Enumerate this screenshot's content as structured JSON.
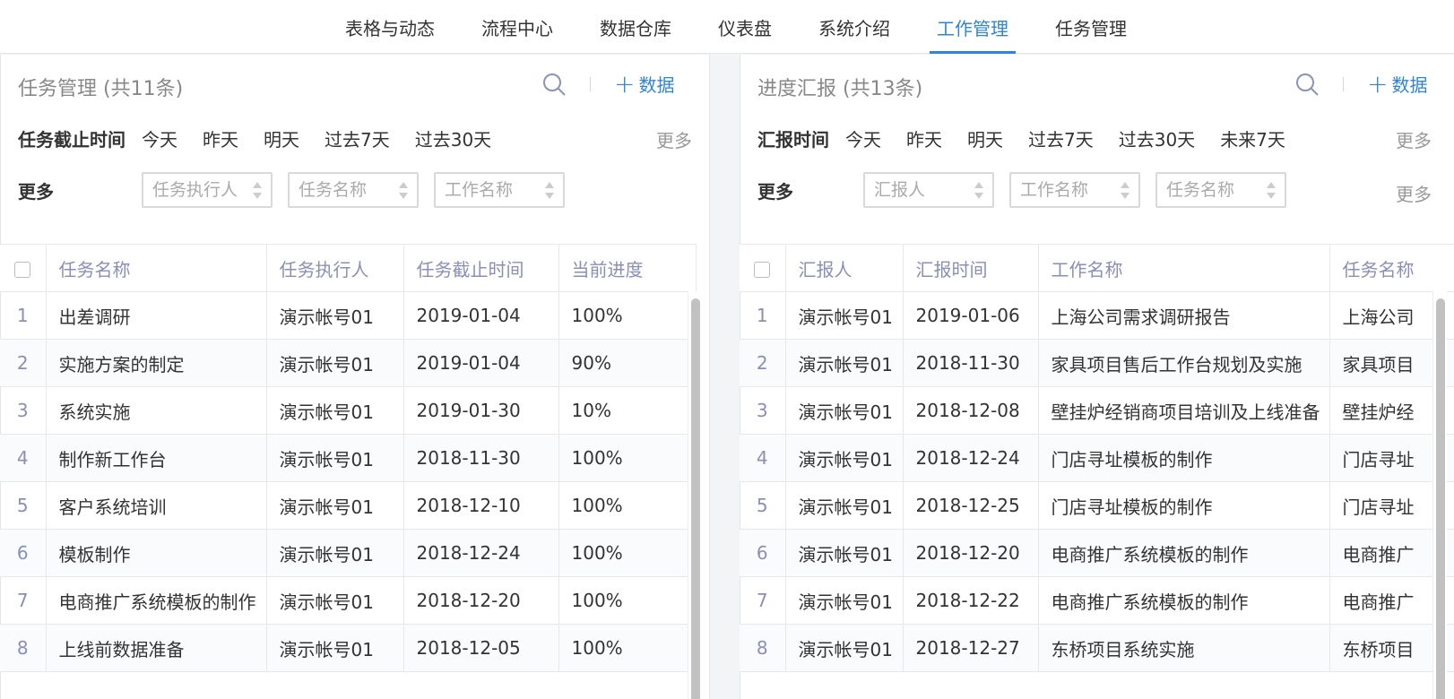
{
  "nav": {
    "tabs": [
      {
        "label": "表格与动态"
      },
      {
        "label": "流程中心"
      },
      {
        "label": "数据仓库"
      },
      {
        "label": "仪表盘"
      },
      {
        "label": "系统介绍"
      },
      {
        "label": "工作管理"
      },
      {
        "label": "任务管理"
      }
    ],
    "active_tab": "工作管理"
  },
  "left": {
    "title": "任务管理 (共11条)",
    "add_label": "数据",
    "filter_label": "任务截止时间",
    "filter_options": [
      "今天",
      "昨天",
      "明天",
      "过去7天",
      "过去30天"
    ],
    "more_label": "更多",
    "more_row_label": "更多",
    "selects": [
      {
        "placeholder": "任务执行人"
      },
      {
        "placeholder": "任务名称"
      },
      {
        "placeholder": "工作名称"
      }
    ],
    "columns": [
      "任务名称",
      "任务执行人",
      "任务截止时间",
      "当前进度"
    ],
    "rows": [
      [
        "1",
        "出差调研",
        "演示帐号01",
        "2019-01-04",
        "100%"
      ],
      [
        "2",
        "实施方案的制定",
        "演示帐号01",
        "2019-01-04",
        "90%"
      ],
      [
        "3",
        "系统实施",
        "演示帐号01",
        "2019-01-30",
        "10%"
      ],
      [
        "4",
        "制作新工作台",
        "演示帐号01",
        "2018-11-30",
        "100%"
      ],
      [
        "5",
        "客户系统培训",
        "演示帐号01",
        "2018-12-10",
        "100%"
      ],
      [
        "6",
        "模板制作",
        "演示帐号01",
        "2018-12-24",
        "100%"
      ],
      [
        "7",
        "电商推广系统模板的制作",
        "演示帐号01",
        "2018-12-20",
        "100%"
      ],
      [
        "8",
        "上线前数据准备",
        "演示帐号01",
        "2018-12-05",
        "100%"
      ]
    ]
  },
  "right": {
    "title": "进度汇报 (共13条)",
    "add_label": "数据",
    "filter_label": "汇报时间",
    "filter_options": [
      "今天",
      "昨天",
      "明天",
      "过去7天",
      "过去30天",
      "未来7天"
    ],
    "more_label": "更多",
    "more_row_label": "更多",
    "selects": [
      {
        "placeholder": "汇报人"
      },
      {
        "placeholder": "工作名称"
      },
      {
        "placeholder": "任务名称"
      }
    ],
    "columns": [
      "汇报人",
      "汇报时间",
      "工作名称",
      "任务名称"
    ],
    "rows": [
      [
        "1",
        "演示帐号01",
        "2019-01-06",
        "上海公司需求调研报告",
        "上海公司"
      ],
      [
        "2",
        "演示帐号01",
        "2018-11-30",
        "家具项目售后工作台规划及实施",
        "家具项目"
      ],
      [
        "3",
        "演示帐号01",
        "2018-12-08",
        "壁挂炉经销商项目培训及上线准备",
        "壁挂炉经"
      ],
      [
        "4",
        "演示帐号01",
        "2018-12-24",
        "门店寻址模板的制作",
        "门店寻址"
      ],
      [
        "5",
        "演示帐号01",
        "2018-12-25",
        "门店寻址模板的制作",
        "门店寻址"
      ],
      [
        "6",
        "演示帐号01",
        "2018-12-20",
        "电商推广系统模板的制作",
        "电商推广"
      ],
      [
        "7",
        "演示帐号01",
        "2018-12-22",
        "电商推广系统模板的制作",
        "电商推广"
      ],
      [
        "8",
        "演示帐号01",
        "2018-12-27",
        "东桥项目系统实施",
        "东桥项目"
      ]
    ]
  },
  "colors": {
    "accent": "#2f86d4",
    "header_text": "#8a8fb8"
  }
}
